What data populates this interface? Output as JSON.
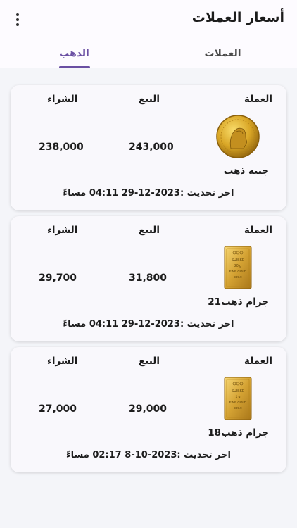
{
  "header": {
    "title": "أسعار العملات",
    "menu_icon": "more-vert-icon"
  },
  "tabs": [
    {
      "label": "العملات",
      "selected": false
    },
    {
      "label": "الذهب",
      "selected": true
    }
  ],
  "colors": {
    "accent": "#6a4fa3",
    "background": "#f4f5f9",
    "card": "#f9f8fc"
  },
  "table_headers": {
    "currency": "العملة",
    "sell": "البيع",
    "buy": "الشراء"
  },
  "items": [
    {
      "name": "جنيه ذهب",
      "icon": "gold-coin-icon",
      "sell": "243,000",
      "buy": "238,000",
      "updated": "اخر تحديث :2023-12-29 04:11 مساءً"
    },
    {
      "name": "جرام ذهب21",
      "icon": "gold-bar-icon",
      "sell": "31,800",
      "buy": "29,700",
      "updated": "اخر تحديث :2023-12-29 04:11 مساءً"
    },
    {
      "name": "جرام ذهب18",
      "icon": "gold-bar-icon",
      "sell": "29,000",
      "buy": "27,000",
      "updated": "اخر تحديث :2023-10-8 02:17 مساءً"
    }
  ],
  "bar_labels": {
    "bar21": [
      "SUISSE",
      "20 g",
      "FINE GOLD",
      "999.9"
    ],
    "bar18": [
      "SUISSE",
      "1 g",
      "FINE GOLD",
      "999.9"
    ]
  }
}
